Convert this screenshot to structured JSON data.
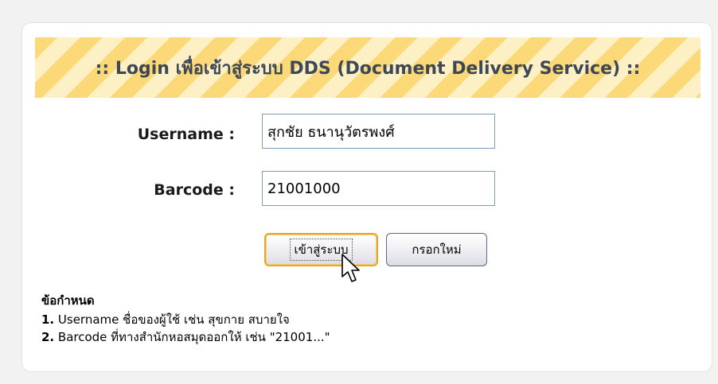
{
  "banner": {
    "title": ":: Login เพื่อเข้าสู่ระบบ DDS (Document Delivery Service) ::"
  },
  "form": {
    "username_label": "Username :",
    "username_value": "สุกชัย ธนานุวัตรพงศ์",
    "barcode_label": "Barcode :",
    "barcode_value": "21001000",
    "login_button": "เข้าสู่ระบบ",
    "reset_button": "กรอกใหม่"
  },
  "rules": {
    "title": "ข้อกำหนด",
    "items": [
      {
        "num": "1.",
        "text": " Username ชื่อของผู้ใช้ เช่น สุขกาย สบายใจ"
      },
      {
        "num": "2.",
        "text": " Barcode ที่ทางสำนักหอสมุดออกให้ เช่น \"21001...\""
      }
    ]
  },
  "colors": {
    "banner_stripe_dark": "#fbd978",
    "banner_stripe_light": "#fdf0c4",
    "banner_text": "#3d4756",
    "focus_border": "#e8a52a"
  },
  "icons": {
    "cursor": "mouse-pointer-icon"
  }
}
